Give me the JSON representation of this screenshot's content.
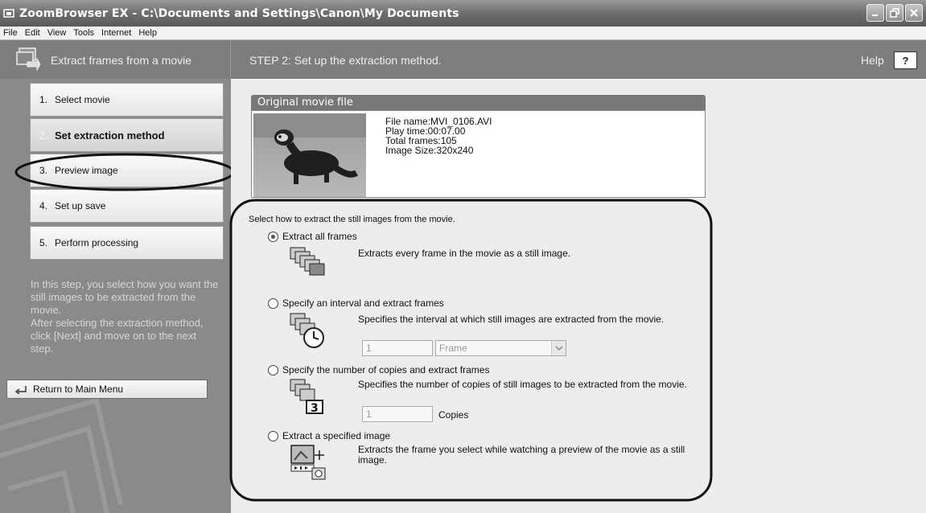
{
  "window": {
    "title": "ZoomBrowser EX  -  C:\\Documents and Settings\\Canon\\My Documents"
  },
  "menu": [
    "File",
    "Edit",
    "View",
    "Tools",
    "Internet",
    "Help"
  ],
  "header": {
    "panel_title": "Extract frames from a movie",
    "step_title": "STEP 2: Set up the extraction method.",
    "help_label": "Help",
    "help_button": "?"
  },
  "sidebar": {
    "steps": [
      {
        "num": "1.",
        "label": "Select movie"
      },
      {
        "num": "2.",
        "label": "Set extraction method"
      },
      {
        "num": "3.",
        "label": "Preview image"
      },
      {
        "num": "4.",
        "label": "Set up save"
      },
      {
        "num": "5.",
        "label": "Perform processing"
      }
    ],
    "description": "In this step, you select how you want the still images to be extracted from the movie.\nAfter selecting the extraction method, click [Next] and move on to the next step.",
    "return_label": "Return to Main Menu"
  },
  "original": {
    "header": "Original movie file",
    "file_name": "File name:MVI_0106.AVI",
    "play_time": "Play time:00:07.00",
    "total_frames": "Total frames:105",
    "image_size": "Image Size:320x240"
  },
  "options": {
    "instruction": "Select how to extract the still images from the movie.",
    "all": {
      "label": "Extract all frames",
      "desc": "Extracts every frame in the movie as a still image."
    },
    "interval": {
      "label": "Specify an interval and extract frames",
      "desc": "Specifies the interval at which still images are extracted from the movie.",
      "value": "1",
      "unit": "Frame"
    },
    "copies": {
      "label": "Specify the number of copies and extract frames",
      "desc": "Specifies the number of copies of still images to be extracted from the movie.",
      "value": "1",
      "unit": "Copies",
      "badge": "3"
    },
    "specified": {
      "label": "Extract a specified image",
      "desc": "Extracts the frame you select while watching a preview of the movie as a still image."
    },
    "selected": "all"
  }
}
